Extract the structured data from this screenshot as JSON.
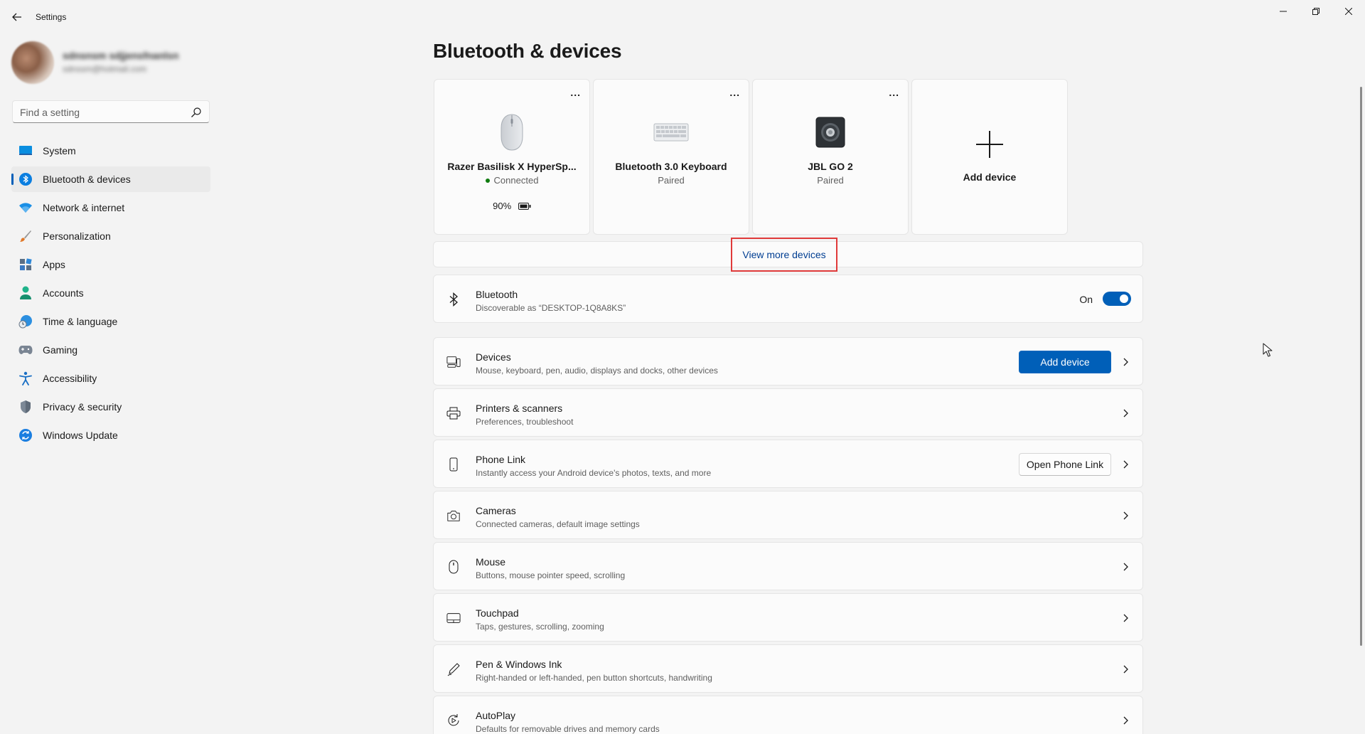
{
  "window": {
    "title": "Settings",
    "controls": {
      "minimize": "minimize-icon",
      "restore": "restore-icon",
      "close": "close-icon"
    }
  },
  "profile": {
    "name": "sdnsnsm sdjjensfnanlsn",
    "email": "sdnssm@hotmail.com"
  },
  "search": {
    "placeholder": "Find a setting"
  },
  "sidebar": {
    "items": [
      {
        "label": "System",
        "icon": "system-icon"
      },
      {
        "label": "Bluetooth & devices",
        "icon": "bluetooth-icon",
        "active": true
      },
      {
        "label": "Network & internet",
        "icon": "wifi-icon"
      },
      {
        "label": "Personalization",
        "icon": "brush-icon"
      },
      {
        "label": "Apps",
        "icon": "apps-icon"
      },
      {
        "label": "Accounts",
        "icon": "accounts-icon"
      },
      {
        "label": "Time & language",
        "icon": "time-language-icon"
      },
      {
        "label": "Gaming",
        "icon": "gaming-icon"
      },
      {
        "label": "Accessibility",
        "icon": "accessibility-icon"
      },
      {
        "label": "Privacy & security",
        "icon": "shield-icon"
      },
      {
        "label": "Windows Update",
        "icon": "windows-update-icon"
      }
    ]
  },
  "main": {
    "title": "Bluetooth & devices",
    "device_cards": [
      {
        "name": "Razer Basilisk X HyperSp...",
        "status": "Connected",
        "battery": "90%",
        "icon": "mouse-device-icon",
        "more": "..."
      },
      {
        "name": "Bluetooth 3.0 Keyboard",
        "status": "Paired",
        "icon": "keyboard-device-icon",
        "more": "..."
      },
      {
        "name": "JBL GO 2",
        "status": "Paired",
        "icon": "speaker-device-icon",
        "more": "..."
      }
    ],
    "add_card": {
      "label": "Add device",
      "icon": "plus-icon"
    },
    "view_more": "View more devices",
    "bluetooth_row": {
      "title": "Bluetooth",
      "subtitle": "Discoverable as “DESKTOP-1Q8A8KS”",
      "toggle_label": "On",
      "toggle_state": true
    },
    "rows": [
      {
        "title": "Devices",
        "subtitle": "Mouse, keyboard, pen, audio, displays and docks, other devices",
        "icon": "devices-icon",
        "button": "Add device"
      },
      {
        "title": "Printers & scanners",
        "subtitle": "Preferences, troubleshoot",
        "icon": "printer-icon"
      },
      {
        "title": "Phone Link",
        "subtitle": "Instantly access your Android device's photos, texts, and more",
        "icon": "phone-icon",
        "button": "Open Phone Link"
      },
      {
        "title": "Cameras",
        "subtitle": "Connected cameras, default image settings",
        "icon": "camera-icon"
      },
      {
        "title": "Mouse",
        "subtitle": "Buttons, mouse pointer speed, scrolling",
        "icon": "mouse-icon"
      },
      {
        "title": "Touchpad",
        "subtitle": "Taps, gestures, scrolling, zooming",
        "icon": "touchpad-icon"
      },
      {
        "title": "Pen & Windows Ink",
        "subtitle": "Right-handed or left-handed, pen button shortcuts, handwriting",
        "icon": "pen-icon"
      },
      {
        "title": "AutoPlay",
        "subtitle": "Defaults for removable drives and memory cards",
        "icon": "autoplay-icon"
      }
    ]
  },
  "colors": {
    "accent": "#005fb8",
    "highlight_border": "#e03a3a",
    "link": "#003e92",
    "connected": "#0f7b0f"
  }
}
